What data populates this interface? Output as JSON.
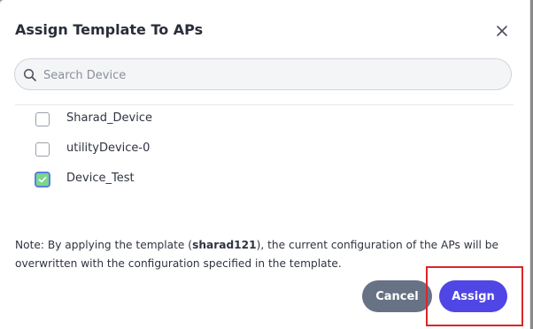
{
  "dialog": {
    "title": "Assign Template To APs",
    "close_icon": "close-icon"
  },
  "search": {
    "placeholder": "Search Device",
    "value": "",
    "icon": "search-icon"
  },
  "devices": [
    {
      "label": "Sharad_Device",
      "checked": false
    },
    {
      "label": "utilityDevice-0",
      "checked": false
    },
    {
      "label": "Device_Test",
      "checked": true
    }
  ],
  "note": {
    "prefix": "Note: By applying the template (",
    "template_name": "sharad121",
    "suffix": "), the current configuration of the APs will be overwritten with the configuration specified in the template."
  },
  "buttons": {
    "cancel": "Cancel",
    "assign": "Assign"
  },
  "colors": {
    "primary": "#4f46e5",
    "secondary": "#687285",
    "checked_fill": "#7bd58d",
    "highlight": "#dc2626"
  }
}
